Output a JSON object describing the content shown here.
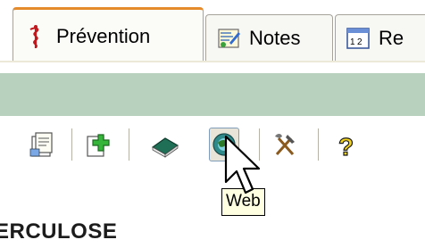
{
  "tabs": [
    {
      "label": "Prévention",
      "icon": "caduceus-icon",
      "active": true
    },
    {
      "label": "Notes",
      "icon": "notes-icon",
      "active": false
    },
    {
      "label": "Re",
      "icon": "calendar-icon",
      "active": false
    }
  ],
  "toolbar": {
    "buttons": [
      "document-icon",
      "add-icon",
      "book-icon",
      "web-globe-icon",
      "tools-icon",
      "help-icon"
    ],
    "pressed": "web-globe-icon"
  },
  "tooltip": {
    "text": "Web"
  },
  "content": {
    "heading": "ERCULOSE"
  },
  "colors": {
    "active_tab_accent": "#e68b2c",
    "band": "#b8d1bf",
    "tooltip_bg": "#ffffe1"
  }
}
